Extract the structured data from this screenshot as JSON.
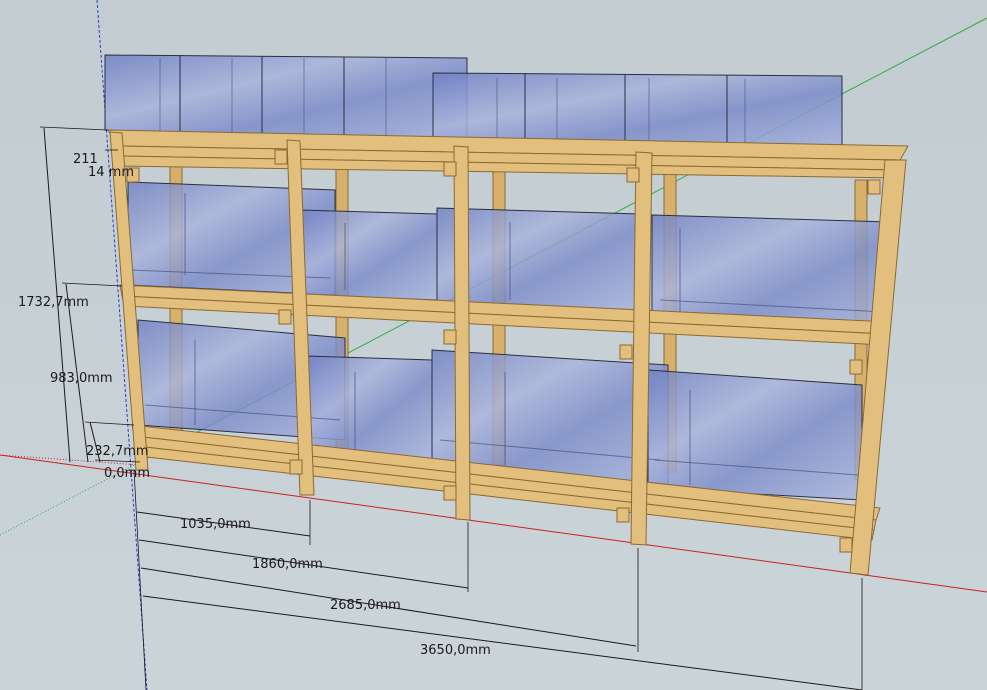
{
  "scene": {
    "background_color": "#c6d0d4",
    "wood_color": "#e3bf7d",
    "wood_edge_color": "#8a6a34",
    "tank_color": "#7f8fc8",
    "axis_red": "#cc1f1f",
    "axis_green": "#2faf3a",
    "axis_blue": "#2a3fd0"
  },
  "dimensions": {
    "horizontal": [
      "1035,0mm",
      "1860,0mm",
      "2685,0mm",
      "3650,0mm"
    ],
    "vertical": [
      "1732,7mm",
      "983,0mm",
      "232,7mm",
      "0,0mm",
      "211",
      "14 mm"
    ]
  }
}
